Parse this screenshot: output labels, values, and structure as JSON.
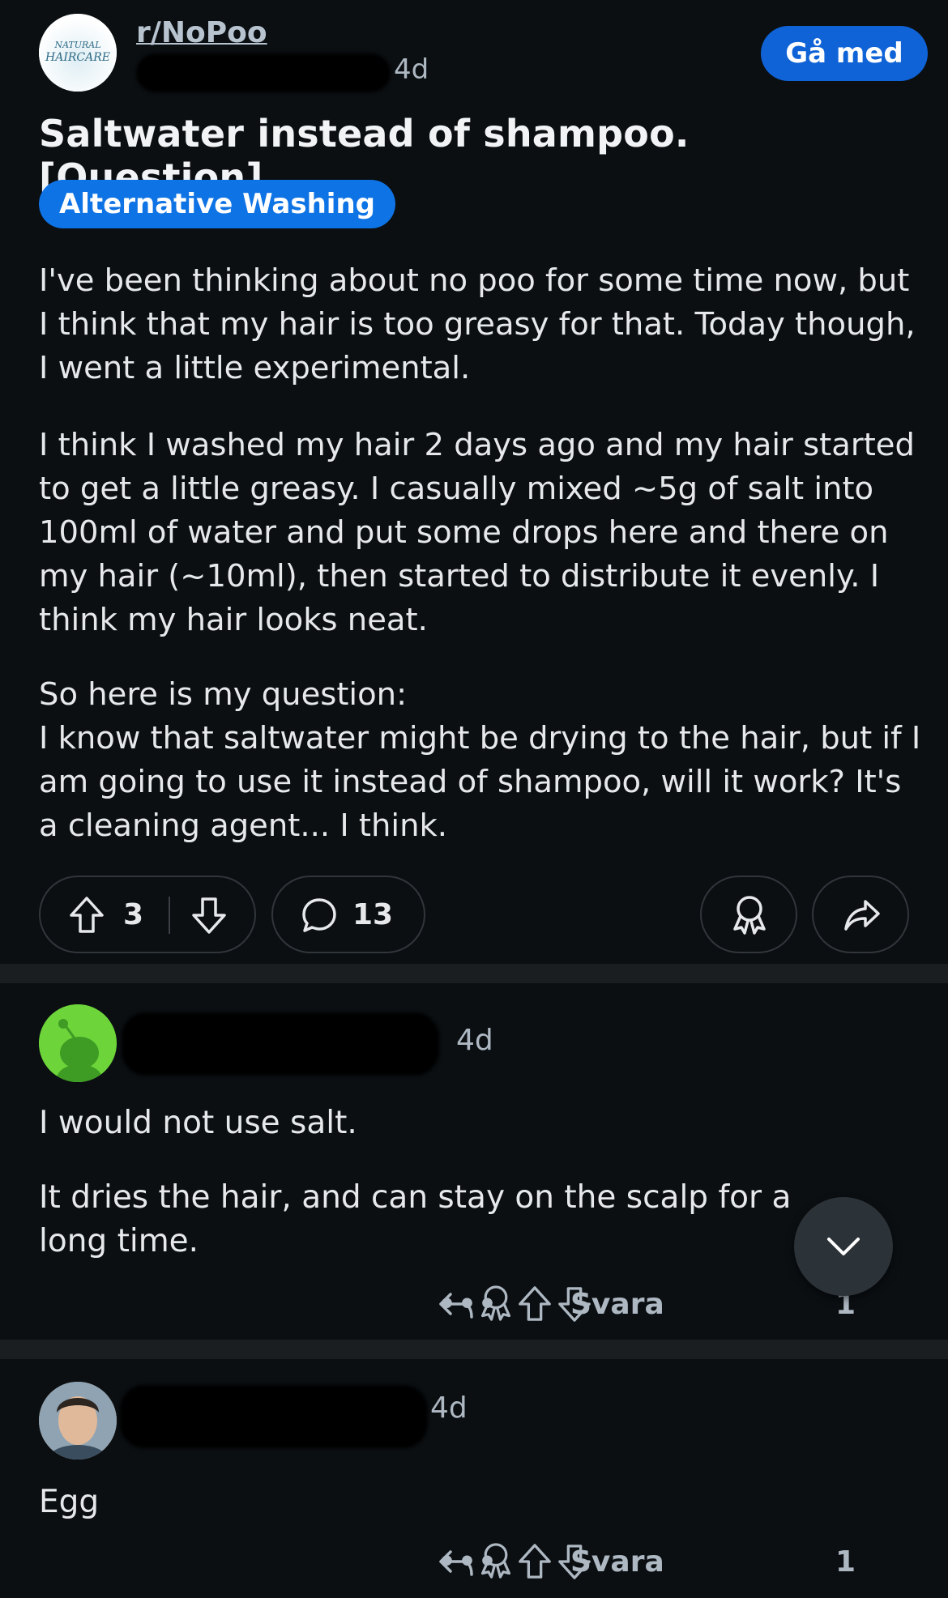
{
  "post": {
    "subreddit": "r/NoPoo",
    "subreddit_avatar_text_line1": "NATURAL",
    "subreddit_avatar_text_line2": "HAIRCARE",
    "age": "4d",
    "join_label": "Gå med",
    "title": "Saltwater instead of shampoo. [Question]",
    "flair": "Alternative Washing",
    "paragraphs": [
      "I've been thinking about no poo for some time now, but I think that my hair is too greasy for that. Today though, I went a little experimental.",
      "I think I washed my hair 2 days ago and my hair started to get a little greasy. I casually mixed ~5g of salt into 100ml of water and put some drops here and there on my hair (~10ml), then started to distribute it evenly. I think my hair looks neat.",
      "So here is my question:",
      "I know that saltwater might be drying to the hair, but if I am going to use it instead of shampoo, will it work? It's a cleaning agent... I think."
    ],
    "upvotes": "3",
    "comments_count": "13"
  },
  "comments": [
    {
      "age": "4d",
      "lines": [
        "I would not use salt.",
        "It dries the hair, and can stay on the scalp for a long time."
      ],
      "reply_label": "Svara",
      "votes": "1"
    },
    {
      "age": "4d",
      "lines": [
        "Egg"
      ],
      "reply_label": "Svara",
      "votes": "1"
    }
  ],
  "icons": {
    "upvote": "arrow-up-icon",
    "downvote": "arrow-down-icon",
    "comment": "comment-bubble-icon",
    "award": "award-icon",
    "share": "share-icon",
    "more": "more-dots-icon",
    "reply": "reply-arrow-icon",
    "scroll": "chevron-down-icon"
  },
  "colors": {
    "background": "#0b0f12",
    "join_button": "#0f63d6",
    "flair": "#0e73e4",
    "text": "#e6e8ea",
    "muted": "#aeb8c2"
  }
}
